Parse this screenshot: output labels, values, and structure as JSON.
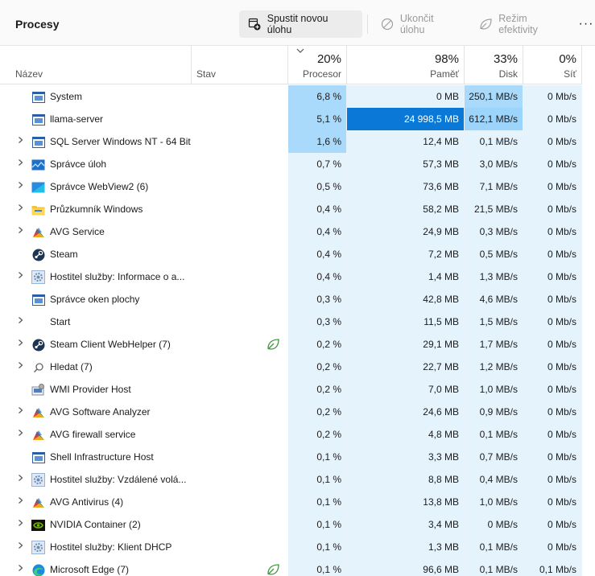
{
  "toolbar": {
    "title": "Procesy",
    "run_task": "Spustit novou úlohu",
    "end_task": "Ukončit úlohu",
    "efficiency": "Režim efektivity",
    "more": "···"
  },
  "columns": {
    "name": "Název",
    "status": "Stav",
    "cpu": {
      "label": "Procesor",
      "total": "20%"
    },
    "memory": {
      "label": "Paměť",
      "total": "98%"
    },
    "disk": {
      "label": "Disk",
      "total": "33%"
    },
    "network": {
      "label": "Síť",
      "total": "0%"
    }
  },
  "colors": {
    "heat_1": "#e5f3fd",
    "heat_2": "#a9dafb",
    "heat_3": "#9dd4fb",
    "heat_max": "#0a78d7",
    "toolbar_bg": "#fafafa"
  },
  "processes": [
    {
      "name": "System",
      "icon": "window-icon",
      "expandable": false,
      "eco": false,
      "cpu": "6,8 %",
      "mem": "0 MB",
      "disk": "250,1 MB/s",
      "net": "0 Mb/s",
      "heat": {
        "cpu": 2,
        "mem": 1,
        "disk": 2,
        "net": 1
      }
    },
    {
      "name": "llama-server",
      "icon": "window-icon",
      "expandable": false,
      "eco": false,
      "cpu": "5,1 %",
      "mem": "24 998,5 MB",
      "disk": "612,1 MB/s",
      "net": "0 Mb/s",
      "heat": {
        "cpu": 2,
        "mem": 4,
        "disk": 3,
        "net": 1
      }
    },
    {
      "name": "SQL Server Windows NT - 64 Bit",
      "icon": "window-icon",
      "expandable": true,
      "eco": false,
      "cpu": "1,6 %",
      "mem": "12,4 MB",
      "disk": "0,1 MB/s",
      "net": "0 Mb/s",
      "heat": {
        "cpu": 2,
        "mem": 1,
        "disk": 1,
        "net": 1
      }
    },
    {
      "name": "Správce úloh",
      "icon": "task-manager-icon",
      "expandable": true,
      "eco": false,
      "cpu": "0,7 %",
      "mem": "57,3 MB",
      "disk": "3,0 MB/s",
      "net": "0 Mb/s",
      "heat": {
        "cpu": 1,
        "mem": 1,
        "disk": 1,
        "net": 1
      }
    },
    {
      "name": "Správce WebView2 (6)",
      "icon": "webview-icon",
      "expandable": true,
      "eco": false,
      "cpu": "0,5 %",
      "mem": "73,6 MB",
      "disk": "7,1 MB/s",
      "net": "0 Mb/s",
      "heat": {
        "cpu": 1,
        "mem": 1,
        "disk": 1,
        "net": 1
      }
    },
    {
      "name": "Průzkumník Windows",
      "icon": "folder-icon",
      "expandable": true,
      "eco": false,
      "cpu": "0,4 %",
      "mem": "58,2 MB",
      "disk": "21,5 MB/s",
      "net": "0 Mb/s",
      "heat": {
        "cpu": 1,
        "mem": 1,
        "disk": 1,
        "net": 1
      }
    },
    {
      "name": "AVG Service",
      "icon": "avg-icon",
      "expandable": true,
      "eco": false,
      "cpu": "0,4 %",
      "mem": "24,9 MB",
      "disk": "0,3 MB/s",
      "net": "0 Mb/s",
      "heat": {
        "cpu": 1,
        "mem": 1,
        "disk": 1,
        "net": 1
      }
    },
    {
      "name": "Steam",
      "icon": "steam-icon",
      "expandable": false,
      "eco": false,
      "cpu": "0,4 %",
      "mem": "7,2 MB",
      "disk": "0,5 MB/s",
      "net": "0 Mb/s",
      "heat": {
        "cpu": 1,
        "mem": 1,
        "disk": 1,
        "net": 1
      }
    },
    {
      "name": "Hostitel služby: Informace o a...",
      "icon": "gear-icon",
      "expandable": true,
      "eco": false,
      "cpu": "0,4 %",
      "mem": "1,4 MB",
      "disk": "1,3 MB/s",
      "net": "0 Mb/s",
      "heat": {
        "cpu": 1,
        "mem": 1,
        "disk": 1,
        "net": 1
      }
    },
    {
      "name": "Správce oken plochy",
      "icon": "window-icon",
      "expandable": false,
      "eco": false,
      "cpu": "0,3 %",
      "mem": "42,8 MB",
      "disk": "4,6 MB/s",
      "net": "0 Mb/s",
      "heat": {
        "cpu": 1,
        "mem": 1,
        "disk": 1,
        "net": 1
      }
    },
    {
      "name": "Start",
      "icon": "none",
      "expandable": true,
      "eco": false,
      "cpu": "0,3 %",
      "mem": "11,5 MB",
      "disk": "1,5 MB/s",
      "net": "0 Mb/s",
      "heat": {
        "cpu": 1,
        "mem": 1,
        "disk": 1,
        "net": 1
      }
    },
    {
      "name": "Steam Client WebHelper (7)",
      "icon": "steam-icon",
      "expandable": true,
      "eco": true,
      "cpu": "0,2 %",
      "mem": "29,1 MB",
      "disk": "1,7 MB/s",
      "net": "0 Mb/s",
      "heat": {
        "cpu": 1,
        "mem": 1,
        "disk": 1,
        "net": 1
      }
    },
    {
      "name": "Hledat (7)",
      "icon": "search-icon",
      "expandable": true,
      "eco": false,
      "cpu": "0,2 %",
      "mem": "22,7 MB",
      "disk": "1,2 MB/s",
      "net": "0 Mb/s",
      "heat": {
        "cpu": 1,
        "mem": 1,
        "disk": 1,
        "net": 1
      }
    },
    {
      "name": "WMI Provider Host",
      "icon": "wmi-icon",
      "expandable": false,
      "eco": false,
      "cpu": "0,2 %",
      "mem": "7,0 MB",
      "disk": "1,0 MB/s",
      "net": "0 Mb/s",
      "heat": {
        "cpu": 1,
        "mem": 1,
        "disk": 1,
        "net": 1
      }
    },
    {
      "name": "AVG Software Analyzer",
      "icon": "avg-icon",
      "expandable": true,
      "eco": false,
      "cpu": "0,2 %",
      "mem": "24,6 MB",
      "disk": "0,9 MB/s",
      "net": "0 Mb/s",
      "heat": {
        "cpu": 1,
        "mem": 1,
        "disk": 1,
        "net": 1
      }
    },
    {
      "name": "AVG firewall service",
      "icon": "avg-icon",
      "expandable": true,
      "eco": false,
      "cpu": "0,2 %",
      "mem": "4,8 MB",
      "disk": "0,1 MB/s",
      "net": "0 Mb/s",
      "heat": {
        "cpu": 1,
        "mem": 1,
        "disk": 1,
        "net": 1
      }
    },
    {
      "name": "Shell Infrastructure Host",
      "icon": "window-icon",
      "expandable": false,
      "eco": false,
      "cpu": "0,1 %",
      "mem": "3,3 MB",
      "disk": "0,7 MB/s",
      "net": "0 Mb/s",
      "heat": {
        "cpu": 1,
        "mem": 1,
        "disk": 1,
        "net": 1
      }
    },
    {
      "name": "Hostitel služby: Vzdálené volá...",
      "icon": "gear-icon",
      "expandable": true,
      "eco": false,
      "cpu": "0,1 %",
      "mem": "8,8 MB",
      "disk": "0,4 MB/s",
      "net": "0 Mb/s",
      "heat": {
        "cpu": 1,
        "mem": 1,
        "disk": 1,
        "net": 1
      }
    },
    {
      "name": "AVG Antivirus (4)",
      "icon": "avg-icon",
      "expandable": true,
      "eco": false,
      "cpu": "0,1 %",
      "mem": "13,8 MB",
      "disk": "1,0 MB/s",
      "net": "0 Mb/s",
      "heat": {
        "cpu": 1,
        "mem": 1,
        "disk": 1,
        "net": 1
      }
    },
    {
      "name": "NVIDIA Container (2)",
      "icon": "nvidia-icon",
      "expandable": true,
      "eco": false,
      "cpu": "0,1 %",
      "mem": "3,4 MB",
      "disk": "0 MB/s",
      "net": "0 Mb/s",
      "heat": {
        "cpu": 1,
        "mem": 1,
        "disk": 1,
        "net": 1
      }
    },
    {
      "name": "Hostitel služby: Klient DHCP",
      "icon": "gear-icon",
      "expandable": true,
      "eco": false,
      "cpu": "0,1 %",
      "mem": "1,3 MB",
      "disk": "0,1 MB/s",
      "net": "0 Mb/s",
      "heat": {
        "cpu": 1,
        "mem": 1,
        "disk": 1,
        "net": 1
      }
    },
    {
      "name": "Microsoft Edge (7)",
      "icon": "edge-icon",
      "expandable": true,
      "eco": true,
      "cpu": "0,1 %",
      "mem": "96,6 MB",
      "disk": "0,1 MB/s",
      "net": "0,1 Mb/s",
      "heat": {
        "cpu": 1,
        "mem": 1,
        "disk": 1,
        "net": 1
      }
    }
  ]
}
